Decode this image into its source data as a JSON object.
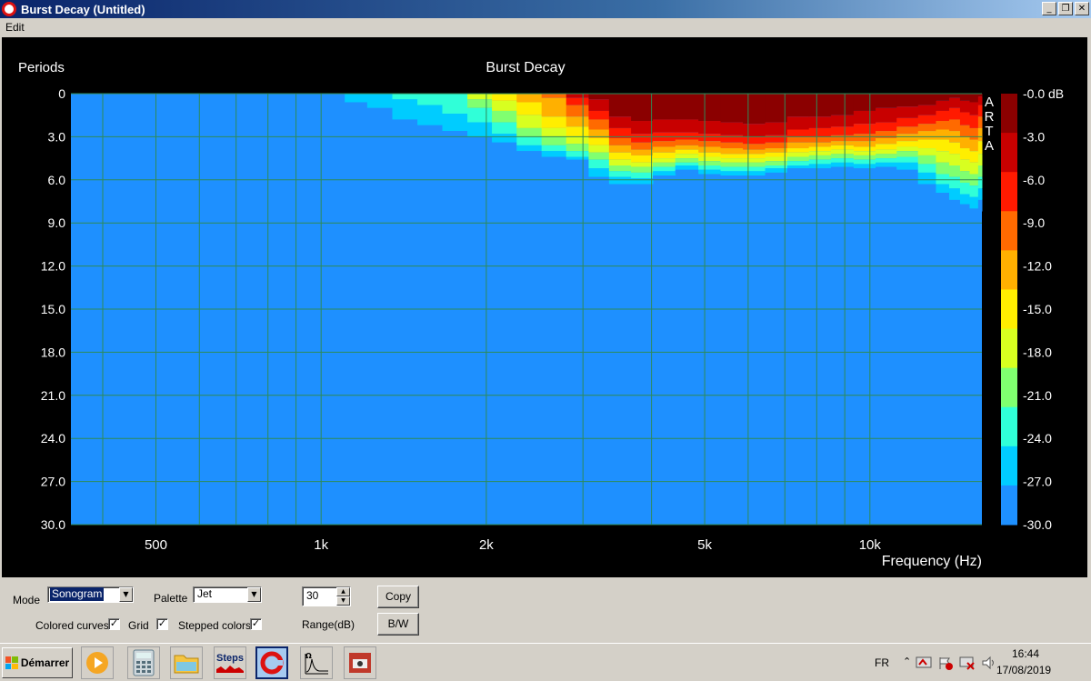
{
  "window": {
    "title": "Burst Decay  (Untitled)",
    "btn_min": "_",
    "btn_restore": "❐",
    "btn_close": "✕"
  },
  "menu": {
    "edit": "Edit"
  },
  "chart_data": {
    "type": "heatmap",
    "title": "Burst Decay",
    "ylabel": "Periods",
    "xlabel": "Frequency (Hz)",
    "y_ticks": [
      "0",
      "3.0",
      "6.0",
      "9.0",
      "12.0",
      "15.0",
      "18.0",
      "21.0",
      "24.0",
      "27.0",
      "30.0"
    ],
    "ylim": [
      0,
      30
    ],
    "x_scale": "log",
    "xlim": [
      350,
      16000
    ],
    "x_ticks": [
      {
        "v": 500,
        "label": "500"
      },
      {
        "v": 1000,
        "label": "1k"
      },
      {
        "v": 2000,
        "label": "2k"
      },
      {
        "v": 5000,
        "label": "5k"
      },
      {
        "v": 10000,
        "label": "10k"
      }
    ],
    "colorbar_labels": [
      "-0.0 dB",
      "-3.0",
      "-6.0",
      "-9.0",
      "-12.0",
      "-15.0",
      "-18.0",
      "-21.0",
      "-24.0",
      "-27.0",
      "-30.0"
    ],
    "colorbar_colors": [
      "#8b0000",
      "#c80000",
      "#ff1a00",
      "#ff6a00",
      "#ffb000",
      "#ffee00",
      "#d8ff20",
      "#80ff70",
      "#30ffd8",
      "#00ccff",
      "#1e90ff"
    ],
    "background_color": "#1e90ff",
    "watermark": "ARTA",
    "decay_columns": [
      {
        "f": 1060,
        "depth": [
          0,
          0,
          0,
          0,
          0,
          0,
          0,
          0,
          0,
          0,
          0
        ]
      },
      {
        "f": 1150,
        "depth": [
          0,
          0,
          0,
          0,
          0,
          0,
          0,
          0,
          0,
          0.6,
          1.3
        ]
      },
      {
        "f": 1280,
        "depth": [
          0,
          0,
          0,
          0,
          0,
          0,
          0,
          0,
          0,
          1.0,
          2.0
        ]
      },
      {
        "f": 1420,
        "depth": [
          0,
          0,
          0,
          0,
          0,
          0,
          0,
          0,
          0.4,
          1.8,
          2.5
        ]
      },
      {
        "f": 1580,
        "depth": [
          0,
          0,
          0,
          0,
          0,
          0,
          0,
          0,
          0.8,
          2.2,
          2.7
        ]
      },
      {
        "f": 1750,
        "depth": [
          0,
          0,
          0,
          0,
          0,
          0,
          0,
          0,
          1.4,
          2.6,
          3.0
        ]
      },
      {
        "f": 1950,
        "depth": [
          0,
          0,
          0,
          0,
          0,
          0,
          0.4,
          1.0,
          2.0,
          3.0,
          3.4
        ]
      },
      {
        "f": 2150,
        "depth": [
          0,
          0,
          0,
          0,
          0,
          0.5,
          1.2,
          2.0,
          2.8,
          3.4,
          3.8
        ]
      },
      {
        "f": 2400,
        "depth": [
          0,
          0,
          0,
          0,
          0.6,
          1.5,
          2.4,
          3.0,
          3.6,
          4.0,
          4.4
        ]
      },
      {
        "f": 2650,
        "depth": [
          0,
          0,
          0,
          0.3,
          1.6,
          2.4,
          3.0,
          3.6,
          4.0,
          4.4,
          4.6
        ]
      },
      {
        "f": 2950,
        "depth": [
          0,
          0.3,
          0.8,
          1.6,
          2.3,
          3.0,
          3.5,
          4.0,
          4.4,
          4.6,
          4.8
        ]
      },
      {
        "f": 3200,
        "depth": [
          0.4,
          1.2,
          1.8,
          2.5,
          3.1,
          3.6,
          4.1,
          4.6,
          5.2,
          5.8,
          6.3
        ]
      },
      {
        "f": 3500,
        "depth": [
          1.6,
          2.4,
          3.1,
          3.6,
          4.1,
          4.6,
          5.0,
          5.4,
          5.8,
          6.3,
          6.8
        ]
      },
      {
        "f": 3850,
        "depth": [
          1.9,
          2.8,
          3.4,
          3.9,
          4.3,
          4.8,
          5.1,
          5.5,
          5.9,
          6.3,
          6.6
        ]
      },
      {
        "f": 4200,
        "depth": [
          1.8,
          2.7,
          3.3,
          3.7,
          4.1,
          4.5,
          4.8,
          5.1,
          5.4,
          5.7,
          6.0
        ]
      },
      {
        "f": 4650,
        "depth": [
          1.8,
          2.7,
          3.2,
          3.6,
          3.9,
          4.2,
          4.5,
          4.8,
          5.0,
          5.3,
          5.6
        ]
      },
      {
        "f": 5100,
        "depth": [
          1.9,
          2.8,
          3.3,
          3.7,
          4.1,
          4.4,
          4.7,
          5.0,
          5.3,
          5.6,
          5.9
        ]
      },
      {
        "f": 5600,
        "depth": [
          2.0,
          2.9,
          3.4,
          3.8,
          4.2,
          4.5,
          4.8,
          5.1,
          5.4,
          5.7,
          6.0
        ]
      },
      {
        "f": 6150,
        "depth": [
          2.1,
          3.0,
          3.5,
          3.9,
          4.2,
          4.5,
          4.8,
          5.1,
          5.4,
          5.7,
          6.0
        ]
      },
      {
        "f": 6750,
        "depth": [
          2.0,
          2.9,
          3.4,
          3.8,
          4.1,
          4.4,
          4.7,
          5.0,
          5.2,
          5.5,
          5.8
        ]
      },
      {
        "f": 7400,
        "depth": [
          1.6,
          2.5,
          3.0,
          3.4,
          3.8,
          4.1,
          4.4,
          4.7,
          5.0,
          5.2,
          5.5
        ]
      },
      {
        "f": 8100,
        "depth": [
          1.6,
          2.4,
          3.0,
          3.4,
          3.7,
          4.0,
          4.3,
          4.6,
          4.9,
          5.2,
          5.5
        ]
      },
      {
        "f": 8900,
        "depth": [
          1.5,
          2.3,
          2.9,
          3.3,
          3.6,
          3.9,
          4.2,
          4.5,
          4.8,
          5.1,
          5.4
        ]
      },
      {
        "f": 9800,
        "depth": [
          1.2,
          2.1,
          2.8,
          3.3,
          3.7,
          4.0,
          4.3,
          4.6,
          4.9,
          5.2,
          5.5
        ]
      },
      {
        "f": 10700,
        "depth": [
          1.0,
          2.0,
          2.6,
          3.1,
          3.5,
          3.9,
          4.2,
          4.5,
          4.8,
          5.1,
          5.5
        ]
      },
      {
        "f": 11700,
        "depth": [
          0.9,
          1.7,
          2.3,
          2.8,
          3.3,
          3.7,
          4.0,
          4.4,
          4.8,
          5.3,
          5.9
        ]
      },
      {
        "f": 12800,
        "depth": [
          0.8,
          1.5,
          2.1,
          2.6,
          3.2,
          3.8,
          4.3,
          4.9,
          5.5,
          6.3,
          7.1
        ]
      },
      {
        "f": 13600,
        "depth": [
          0.5,
          1.2,
          1.9,
          2.5,
          3.2,
          4.0,
          4.8,
          5.6,
          6.3,
          6.9,
          7.4
        ]
      },
      {
        "f": 14300,
        "depth": [
          0.3,
          1.0,
          1.8,
          2.6,
          3.4,
          4.2,
          5.0,
          5.8,
          6.6,
          7.4,
          8.2
        ]
      },
      {
        "f": 14900,
        "depth": [
          0.5,
          1.3,
          2.2,
          3.0,
          3.8,
          4.6,
          5.4,
          6.2,
          7.0,
          7.7,
          8.5
        ]
      },
      {
        "f": 15500,
        "depth": [
          0.6,
          1.5,
          2.4,
          3.2,
          4.0,
          4.8,
          5.6,
          6.4,
          7.2,
          8.0,
          8.7
        ]
      },
      {
        "f": 16000,
        "depth": [
          0.2,
          0.8,
          1.6,
          2.4,
          3.3,
          4.2,
          5.0,
          5.8,
          6.6,
          7.4,
          8.2
        ]
      }
    ]
  },
  "controls": {
    "mode_label": "Mode",
    "mode_value": "Sonogram",
    "palette_label": "Palette",
    "palette_value": "Jet",
    "range_value": "30",
    "range_label": "Range(dB)",
    "copy_button": "Copy",
    "bw_button": "B/W",
    "colored_curves_label": "Colored curves",
    "colored_curves_checked": "✓",
    "grid_label": "Grid",
    "grid_checked": "✓",
    "stepped_colors_label": "Stepped colors",
    "stepped_colors_checked": "✓"
  },
  "taskbar": {
    "start_label": "Démarrer",
    "steps_label": "Steps",
    "language": "FR",
    "time": "16:44",
    "date": "17/08/2019"
  }
}
